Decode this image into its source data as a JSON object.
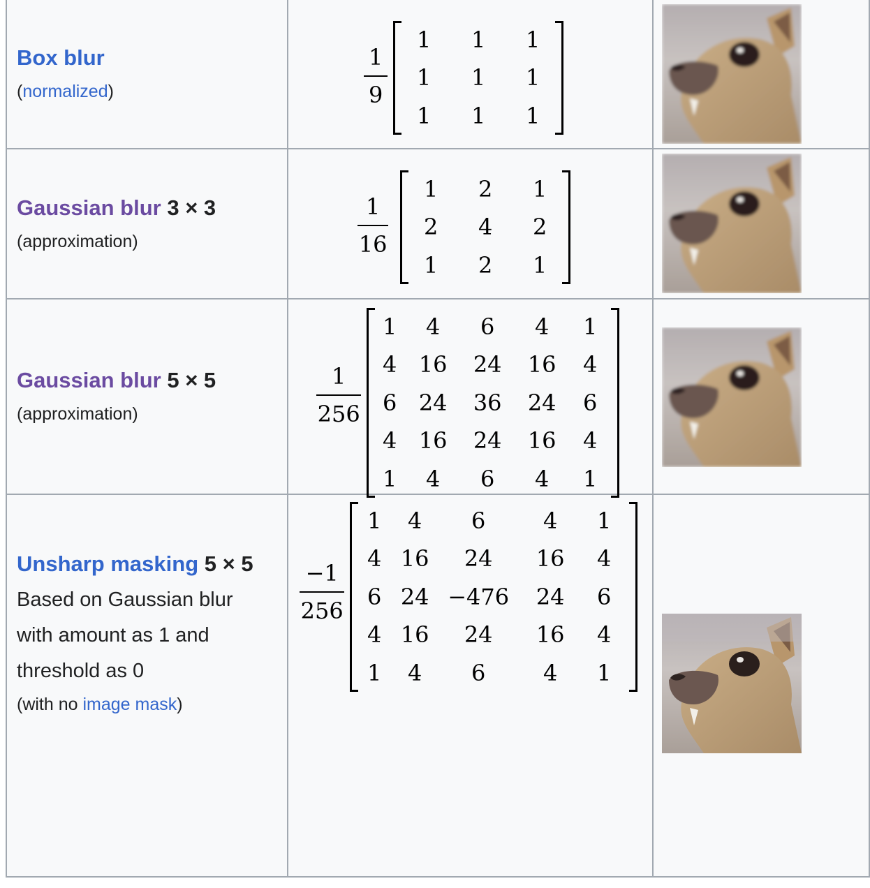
{
  "rows": [
    {
      "title_link": "Box blur",
      "title_suffix": "",
      "note_before": "(",
      "note_link": "normalized",
      "note_after": ")",
      "frac_num": "1",
      "frac_den": "9",
      "matrix": [
        [
          "1",
          "1",
          "1"
        ],
        [
          "1",
          "1",
          "1"
        ],
        [
          "1",
          "1",
          "1"
        ]
      ]
    },
    {
      "title_link": "Gaussian blur",
      "title_suffix": "3 × 3",
      "note": "(approximation)",
      "frac_num": "1",
      "frac_den": "16",
      "matrix": [
        [
          "1",
          "2",
          "1"
        ],
        [
          "2",
          "4",
          "2"
        ],
        [
          "1",
          "2",
          "1"
        ]
      ]
    },
    {
      "title_link": "Gaussian blur",
      "title_suffix": "5 × 5",
      "note": "(approximation)",
      "frac_num": "1",
      "frac_den": "256",
      "matrix": [
        [
          "1",
          "4",
          "6",
          "4",
          "1"
        ],
        [
          "4",
          "16",
          "24",
          "16",
          "4"
        ],
        [
          "6",
          "24",
          "36",
          "24",
          "6"
        ],
        [
          "4",
          "16",
          "24",
          "16",
          "4"
        ],
        [
          "1",
          "4",
          "6",
          "4",
          "1"
        ]
      ]
    },
    {
      "title_link": "Unsharp masking",
      "title_suffix": "5 × 5",
      "desc_lines": [
        "Based on Gaussian blur",
        "with amount as 1 and",
        "threshold as 0"
      ],
      "note_before": "(with no ",
      "note_link": "image mask",
      "note_after": ")",
      "frac_num": "−1",
      "frac_den": "256",
      "matrix": [
        [
          "1",
          "4",
          "6",
          "4",
          "1"
        ],
        [
          "4",
          "16",
          "24",
          "16",
          "4"
        ],
        [
          "6",
          "24",
          "−476",
          "24",
          "6"
        ],
        [
          "4",
          "16",
          "24",
          "16",
          "4"
        ],
        [
          "1",
          "4",
          "6",
          "4",
          "1"
        ]
      ]
    }
  ],
  "images": [
    "blurred animal head photo",
    "blurred animal head photo",
    "blurred animal head photo",
    "sharpened animal head photo"
  ],
  "colors": {
    "link": "#3366cc",
    "visited_link": "#6b4ba1",
    "border": "#a2a9b1",
    "cell_bg": "#f8f9fa"
  }
}
